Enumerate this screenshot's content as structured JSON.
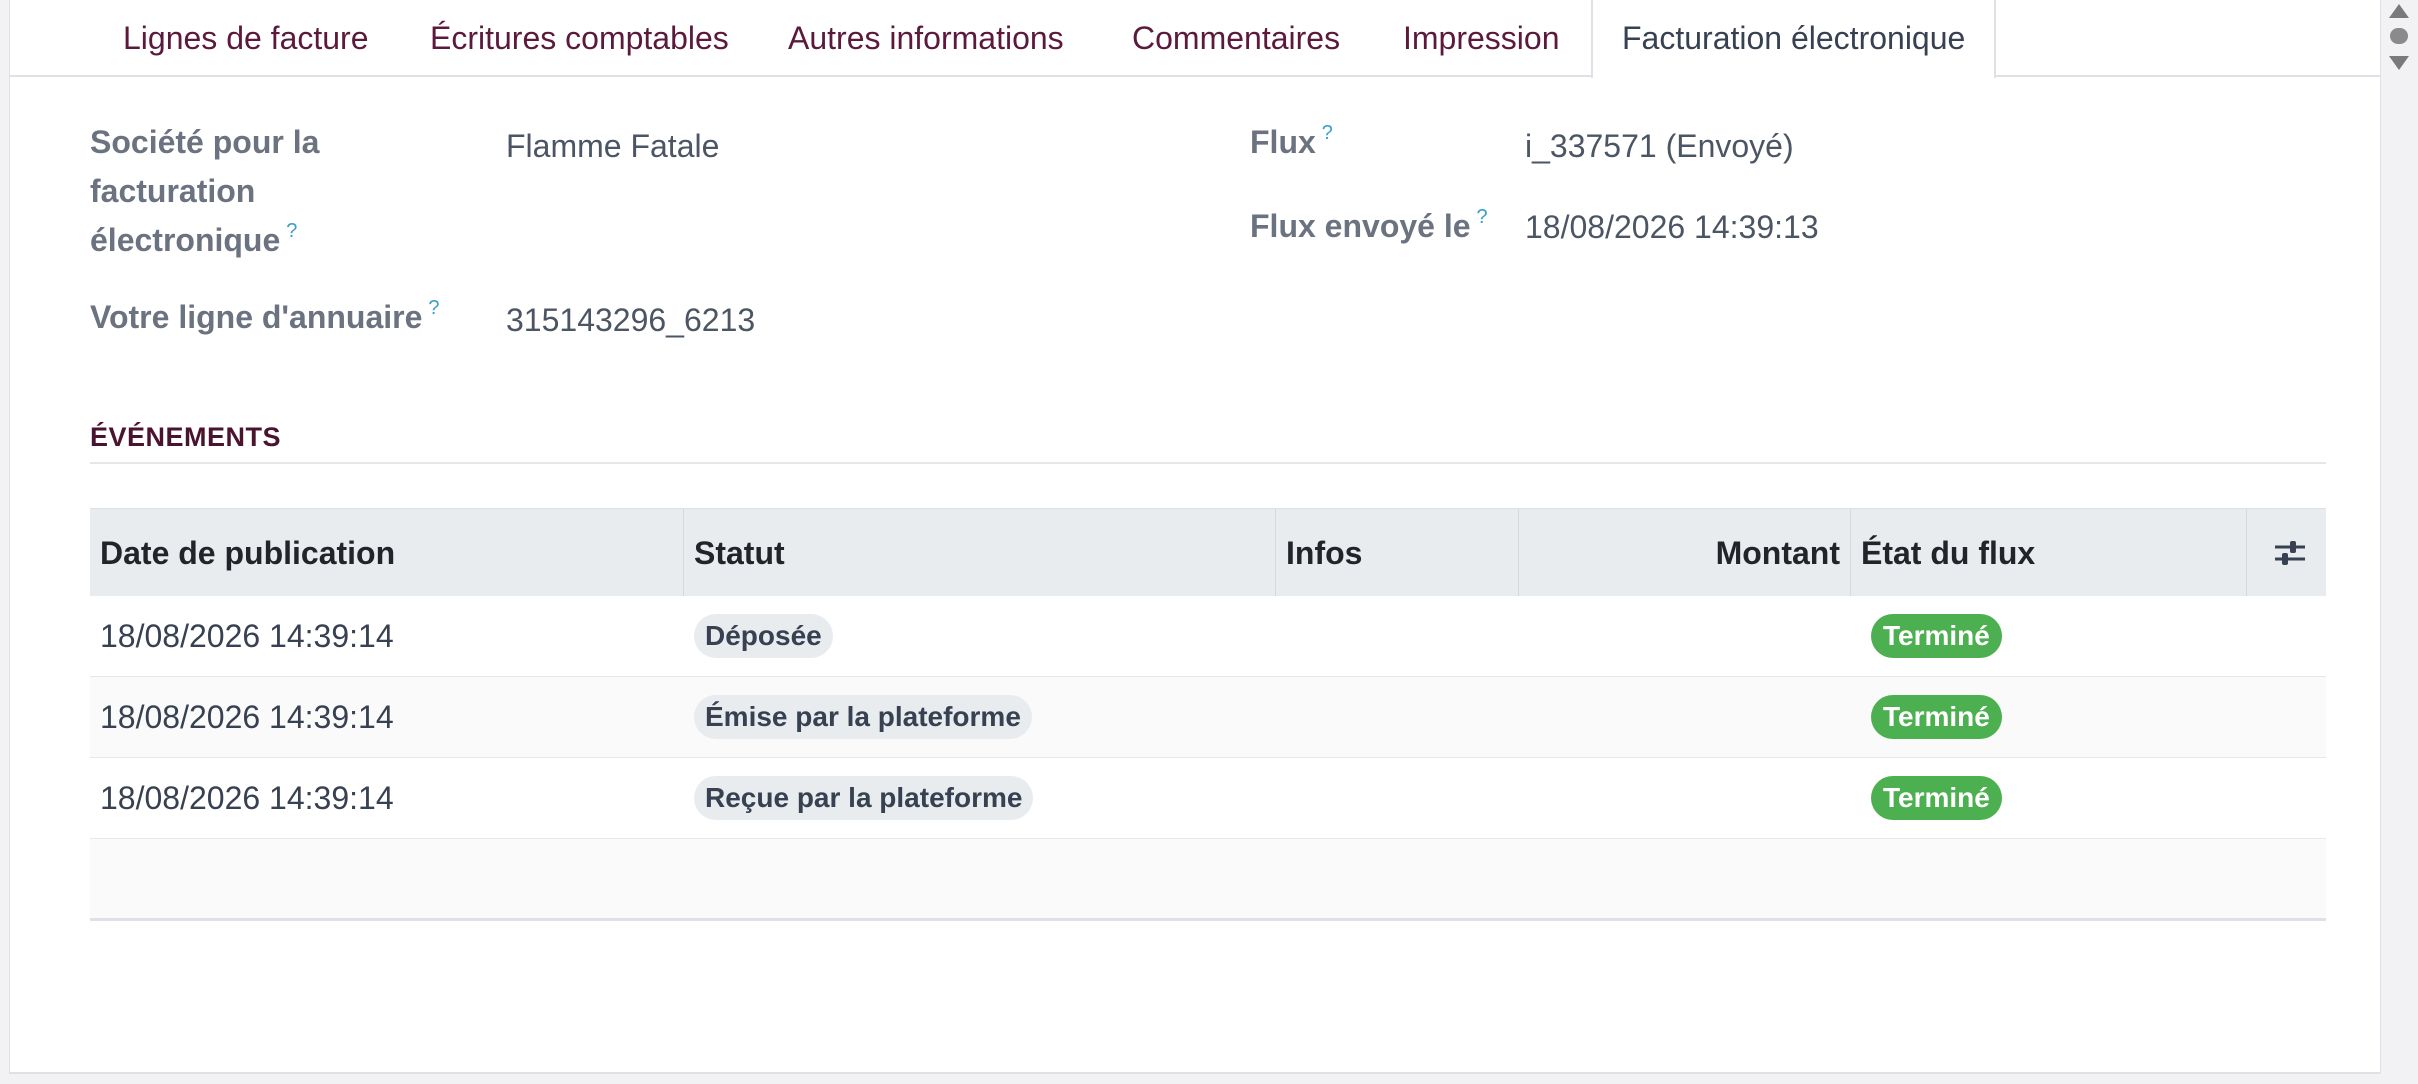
{
  "tabs": [
    {
      "label": "Lignes de facture"
    },
    {
      "label": "Écritures comptables"
    },
    {
      "label": "Autres informations"
    },
    {
      "label": "Commentaires"
    },
    {
      "label": "Impression"
    },
    {
      "label": "Facturation électronique",
      "active": true
    }
  ],
  "form": {
    "company_label_l1": "Société pour la",
    "company_label_l2": "facturation",
    "company_label_l3": "électronique",
    "company_value": "Flamme Fatale",
    "directory_label": "Votre ligne d'annuaire",
    "directory_value": "315143296_6213",
    "flow_label": "Flux",
    "flow_value": "i_337571 (Envoyé)",
    "sent_label": "Flux envoyé le",
    "sent_value": "18/08/2026 14:39:13",
    "help_mark": "?"
  },
  "events": {
    "title": "ÉVÉNEMENTS",
    "columns": {
      "date": "Date de publication",
      "status": "Statut",
      "infos": "Infos",
      "amount": "Montant",
      "flow_state": "État du flux"
    },
    "rows": [
      {
        "date": "18/08/2026 14:39:14",
        "status": "Déposée",
        "infos": "",
        "amount": "",
        "flow_state": "Terminé"
      },
      {
        "date": "18/08/2026 14:39:14",
        "status": "Émise par la plateforme",
        "infos": "",
        "amount": "",
        "flow_state": "Terminé"
      },
      {
        "date": "18/08/2026 14:39:14",
        "status": "Reçue par la plateforme",
        "infos": "",
        "amount": "",
        "flow_state": "Terminé"
      }
    ]
  },
  "colors": {
    "tab_text": "#5b1a3c",
    "section_title": "#4a1430",
    "done_badge": "#4caf50",
    "status_badge": "#e9ecef",
    "help_mark": "#3aa0c8"
  },
  "icons": {
    "optional_columns": "sliders-icon"
  }
}
